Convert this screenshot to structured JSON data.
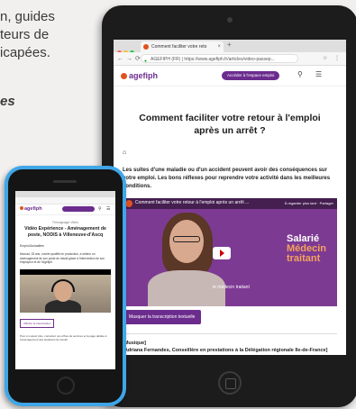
{
  "background_text": {
    "line1": "n, guides",
    "line2": "teurs de",
    "line3": "icapées.",
    "line4": "es"
  },
  "tablet": {
    "tab": {
      "title": "Comment faciliter votre reto"
    },
    "url": {
      "site": "AGEFIPH (FR)",
      "address": "https://www.agefiph.fr/articles/video-passep..."
    },
    "header": {
      "logo": "agefiph",
      "listen_label": "Accéder à l'espace emploi"
    },
    "article": {
      "title": "Comment faciliter votre retour à l'emploi après un arrêt ?",
      "intro": "Les suites d'une maladie ou d'un accident peuvent avoir des conséquences sur votre emploi. Les bons réflexes pour reprendre votre activité dans les meilleures conditions.",
      "video": {
        "title": "Comment faciliter votre retour à l'emploi après un arrêt ...",
        "watch_later": "À regarder plus tard",
        "share": "Partager",
        "tag_line1": "Salarié",
        "tag_line2": "Médecin",
        "tag_line3": "traitant",
        "subtitle": "le médecin traitant"
      },
      "transcript_button": "Masquer la transcription textuelle",
      "transcript_line1": "[Musique]",
      "transcript_line2": "[Adriana Fernandes, Conseillère en prestations à la Délégation régionale Ile-de-France]"
    }
  },
  "phone": {
    "header": {
      "logo": "agefiph"
    },
    "kicker": "Témoignage Vidéo",
    "title": "Vidéo Expérience - Aménagement de poste, NODIS à Villeneuve-d'Ascq",
    "home": "Emploi/Actualités",
    "text": "Mourad, 33 ans, ouvrier qualifié en production, a obtenu un aménagement de son poste de travail grâce à l'intervention de son employeur et de l'Agefiph.",
    "button": "Afficher la transcription",
    "footer": "Pour en savoir plus, consultez nos offres de services et la page dédiée à l'aménagement des situations de travail."
  }
}
